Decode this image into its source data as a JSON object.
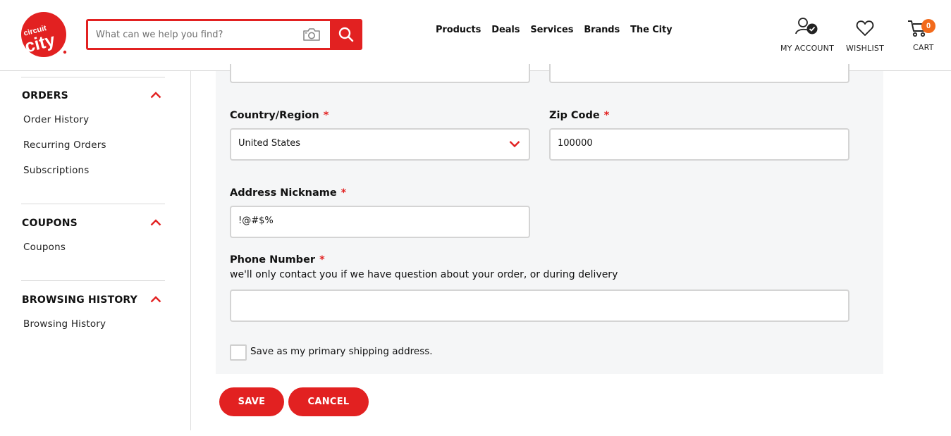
{
  "header": {
    "logo_text": "circuit city",
    "search": {
      "placeholder": "What can we help you find?",
      "value": ""
    },
    "nav": [
      "Products",
      "Deals",
      "Services",
      "Brands",
      "The City"
    ],
    "account_label": "MY ACCOUNT",
    "wishlist_label": "WISHLIST",
    "cart_label": "CART",
    "cart_count": "0"
  },
  "sidebar": {
    "sections": [
      {
        "heading": "ORDERS",
        "items": [
          "Order History",
          "Recurring Orders",
          "Subscriptions"
        ]
      },
      {
        "heading": "COUPONS",
        "items": [
          "Coupons"
        ]
      },
      {
        "heading": "BROWSING HISTORY",
        "items": [
          "Browsing History"
        ]
      }
    ]
  },
  "form": {
    "country": {
      "label": "Country/Region",
      "required_mark": "*",
      "value": "United States"
    },
    "zip": {
      "label": "Zip Code",
      "required_mark": "*",
      "value": "100000"
    },
    "nickname": {
      "label": "Address Nickname",
      "required_mark": "*",
      "value": "!@#$%"
    },
    "phone": {
      "label": "Phone Number",
      "required_mark": "*",
      "help": "we'll only contact you if we have question about your order, or during delivery",
      "value": ""
    },
    "primary_checkbox": {
      "label": "Save as my primary shipping address.",
      "checked": false
    }
  },
  "actions": {
    "save": "SAVE",
    "cancel": "CANCEL"
  },
  "colors": {
    "brand_red": "#e22121",
    "badge_orange": "#f26a1b",
    "panel_bg": "#f5f6f7"
  }
}
